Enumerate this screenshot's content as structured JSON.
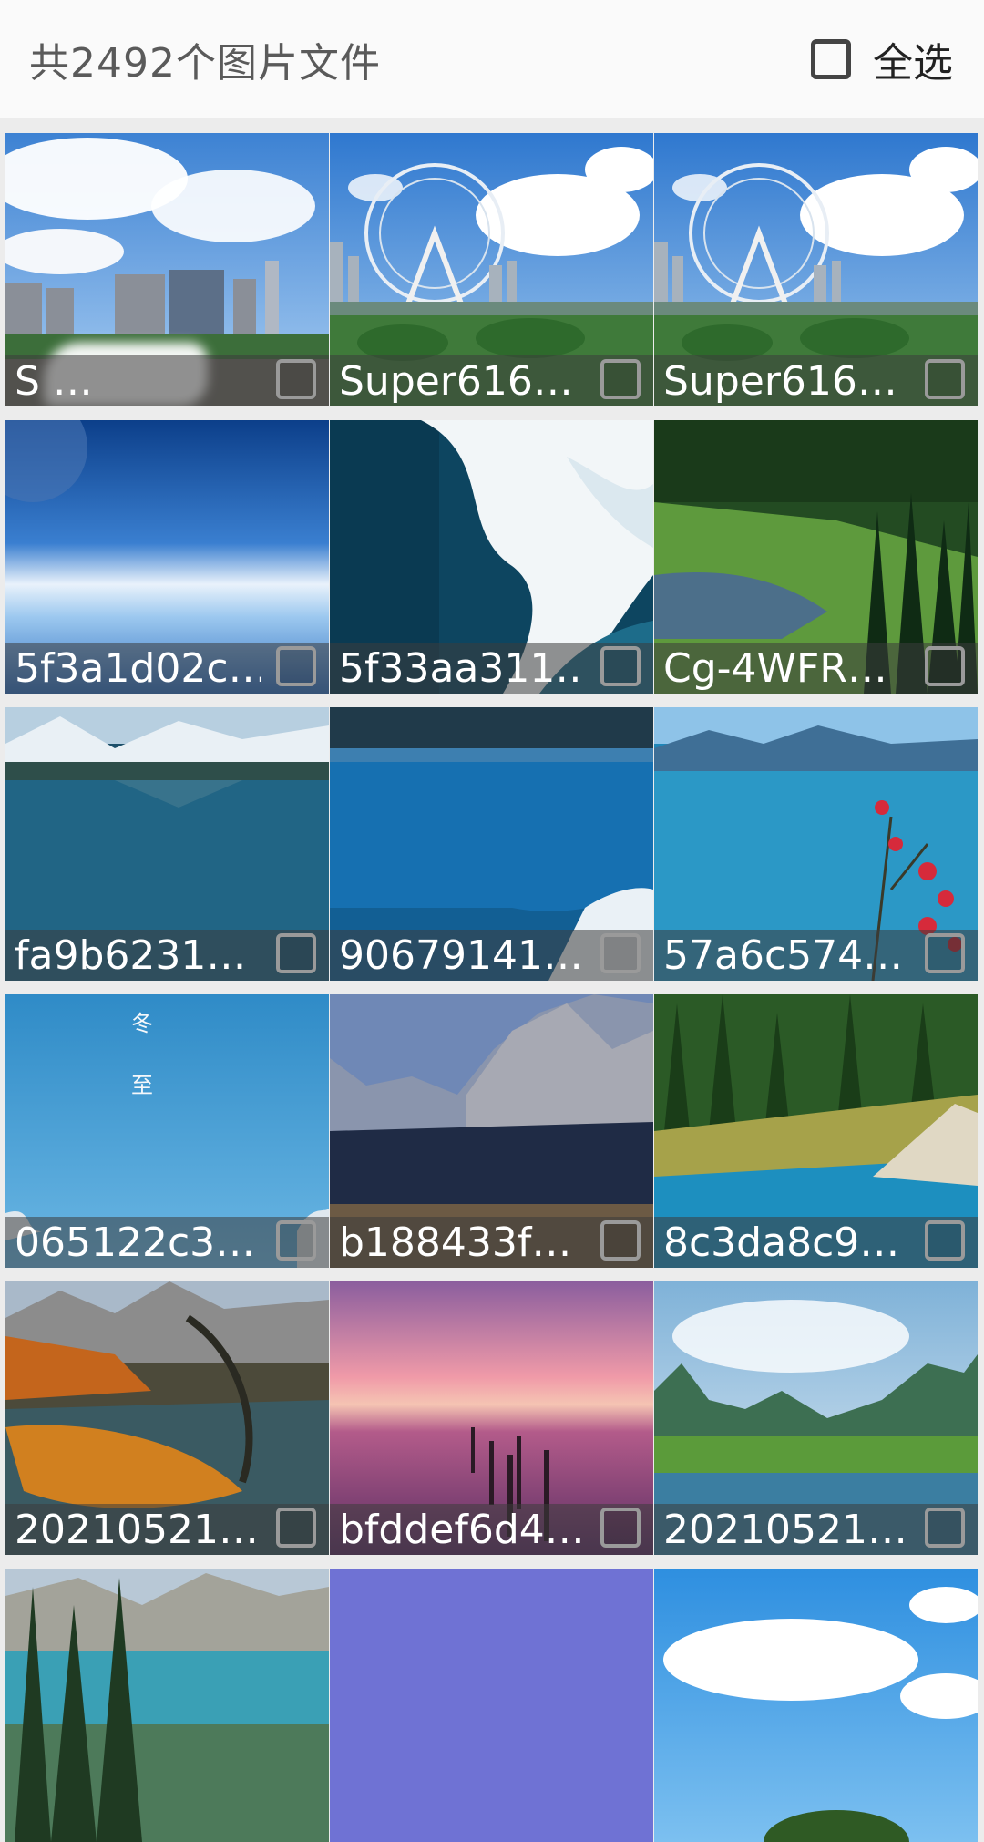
{
  "header": {
    "count_text": "共2492个图片文件",
    "select_all_label": "全选"
  },
  "tiles": [
    {
      "name": "S                 …",
      "scene": "city-sky"
    },
    {
      "name": "Super616…",
      "scene": "ferris-wheel"
    },
    {
      "name": "Super616…",
      "scene": "ferris-wheel"
    },
    {
      "name": "5f3a1d02c…",
      "scene": "earth-horizon"
    },
    {
      "name": "5f33aa311…",
      "scene": "ocean-wave"
    },
    {
      "name": "Cg-4WFR…",
      "scene": "forest-lake"
    },
    {
      "name": "fa9b6231…",
      "scene": "mountain-reflection"
    },
    {
      "name": "90679141…",
      "scene": "blue-lake"
    },
    {
      "name": "57a6c574…",
      "scene": "lake-red-flowers"
    },
    {
      "name": "065122c3…",
      "scene": "blue-winter",
      "overlay_text": [
        "冬",
        "至"
      ]
    },
    {
      "name": "b188433f…",
      "scene": "mountains-pines"
    },
    {
      "name": "8c3da8c9…",
      "scene": "turquoise-forest-lake"
    },
    {
      "name": "20210521…",
      "scene": "autumn-river"
    },
    {
      "name": "bfddef6d4…",
      "scene": "pink-sunset-pier"
    },
    {
      "name": "20210521…",
      "scene": "green-hills-river"
    },
    {
      "name": "",
      "scene": "alpine-lake"
    },
    {
      "name": "",
      "scene": "purple-solid"
    },
    {
      "name": "",
      "scene": "clouds-sky"
    }
  ],
  "colors": {
    "background": "#ececec",
    "header_bg": "#fafafa",
    "caption_bg": "rgba(60,60,60,0.55)",
    "caption_text": "#ffffff"
  }
}
